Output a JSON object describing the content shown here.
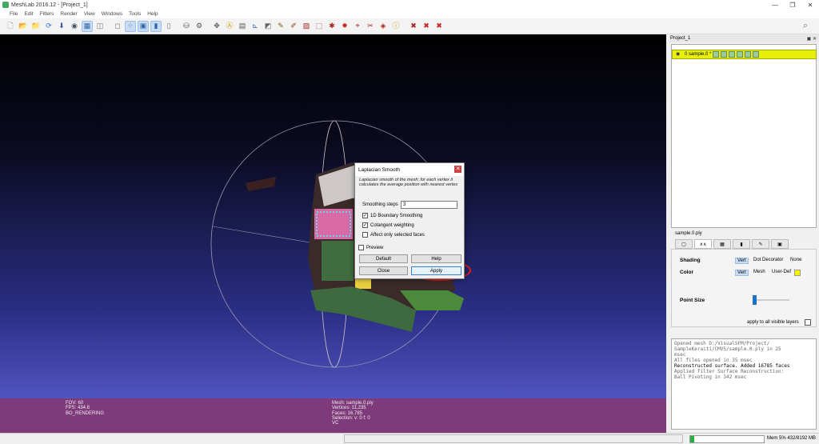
{
  "window": {
    "title": "MeshLab 2016.12 - [Project_1]",
    "minimize": "—",
    "maximize": "❐",
    "close": "✕"
  },
  "menu": [
    "File",
    "Edit",
    "Filters",
    "Render",
    "View",
    "Windows",
    "Tools",
    "Help"
  ],
  "toolbar": [
    {
      "icon": "new-project-icon",
      "glyph": "🗋",
      "color": "#888888"
    },
    {
      "icon": "open-project-icon",
      "glyph": "📂",
      "color": "#d4a017"
    },
    {
      "icon": "import-mesh-icon",
      "glyph": "📁",
      "color": "#d4a017"
    },
    {
      "icon": "reload-icon",
      "glyph": "⟳",
      "color": "#2a7ad4"
    },
    {
      "icon": "export-mesh-icon",
      "glyph": "⬇",
      "color": "#3a5aa8"
    },
    {
      "icon": "snapshot-icon",
      "glyph": "◉",
      "color": "#445566"
    },
    {
      "icon": "wireframe-icon",
      "glyph": "▦",
      "color": "#3366aa",
      "active": true
    },
    {
      "icon": "hidden-lines-icon",
      "glyph": "◫",
      "color": "#777777"
    },
    {
      "icon": "sep"
    },
    {
      "icon": "bbox-icon",
      "glyph": "◻",
      "color": "#777777"
    },
    {
      "icon": "points-icon",
      "glyph": "⁘",
      "color": "#3366aa",
      "active": true
    },
    {
      "icon": "flat-lines-icon",
      "glyph": "▣",
      "color": "#3366aa",
      "active": true
    },
    {
      "icon": "flat-icon",
      "glyph": "▮",
      "color": "#3366aa",
      "active": true
    },
    {
      "icon": "smooth-icon",
      "glyph": "▯",
      "color": "#777777"
    },
    {
      "icon": "sep"
    },
    {
      "icon": "layers-icon",
      "glyph": "⛁",
      "color": "#555555"
    },
    {
      "icon": "manipulator-icon",
      "glyph": "⚙",
      "color": "#555555"
    },
    {
      "icon": "sep"
    },
    {
      "icon": "lighting-icon",
      "glyph": "✥",
      "color": "#555555"
    },
    {
      "icon": "annotation-icon",
      "glyph": "Ⓐ",
      "color": "#c8a000"
    },
    {
      "icon": "measure-icon",
      "glyph": "▤",
      "color": "#555555"
    },
    {
      "icon": "axis-icon",
      "glyph": "⊾",
      "color": "#3366aa"
    },
    {
      "icon": "align-icon",
      "glyph": "◩",
      "color": "#666666"
    },
    {
      "icon": "paint-icon",
      "glyph": "✎",
      "color": "#7a5a20"
    },
    {
      "icon": "brush-icon",
      "glyph": "✐",
      "color": "#884422"
    },
    {
      "icon": "select-faces-icon",
      "glyph": "▨",
      "color": "#aa2222"
    },
    {
      "icon": "select-vertices-icon",
      "glyph": "⬚",
      "color": "#aa2222"
    },
    {
      "icon": "select-connected-icon",
      "glyph": "✱",
      "color": "#aa2222"
    },
    {
      "icon": "pick-points-icon",
      "glyph": "✸",
      "color": "#cc2222"
    },
    {
      "icon": "reference-icon",
      "glyph": "⌖",
      "color": "#aa2222"
    },
    {
      "icon": "cut-icon",
      "glyph": "✂",
      "color": "#aa2222"
    },
    {
      "icon": "fill-icon",
      "glyph": "◈",
      "color": "#aa2222"
    },
    {
      "icon": "info-icon",
      "glyph": "ⓘ",
      "color": "#c8a000"
    },
    {
      "icon": "sep"
    },
    {
      "icon": "delete-selected-icon",
      "glyph": "✖",
      "color": "#aa2222"
    },
    {
      "icon": "delete-faces-icon",
      "glyph": "✖",
      "color": "#cc2222"
    },
    {
      "icon": "delete-vertices-icon",
      "glyph": "✖",
      "color": "#cc2222"
    }
  ],
  "viewport_info": {
    "left": [
      "FOV: 60",
      "FPS:   434.8",
      "BO_RENDERING"
    ],
    "right": [
      "Mesh: sample.0.ply",
      "Vertices: 11,235",
      "Faces: 16,785",
      "Selection: v: 0 f: 0",
      "VC"
    ]
  },
  "layers": {
    "header": "Project_1",
    "controls": "▣ ✕",
    "mesh_label": "0  sample.0 *"
  },
  "render_panel": {
    "mesh_name": "sample.0.ply",
    "tabs": [
      "▢",
      "∧∧",
      "▦",
      "▮",
      "✎",
      "▣"
    ],
    "shading_label": "Shading",
    "shading_options": [
      "Vert",
      "Dot Decorator",
      "None"
    ],
    "color_label": "Color",
    "color_options": [
      "Vert",
      "Mesh",
      "User-Def"
    ],
    "user_color": "#f5f500",
    "point_size_label": "Point Size",
    "apply_all": "apply to all visible layers"
  },
  "log": [
    {
      "text": "Opened mesh D:/VisualSFM/Project/",
      "strong": false
    },
    {
      "text": "SampleKeraiti/CMVS/sample.0.ply in 25",
      "strong": false
    },
    {
      "text": "msec",
      "strong": false
    },
    {
      "text": "All files opened in 35 msec",
      "strong": false
    },
    {
      "text": "Reconstructed surface. Added 16785 faces",
      "strong": true
    },
    {
      "text": "Applied filter Surface Reconstruction:",
      "strong": false
    },
    {
      "text": "Ball Pivoting in 342 msec",
      "strong": false
    }
  ],
  "status": {
    "memory": "Mem 5% 432/8192 MB",
    "memory_fraction": 0.05
  },
  "dialog": {
    "title": "Laplacian Smooth",
    "close": "✕",
    "description": "Laplacian smooth of the mesh: for each vertex it calculates the average position with nearest vertex",
    "smoothing_steps_label": "Smoothing steps",
    "smoothing_steps_value": "3",
    "boundary_label": "1D Boundary Smoothing",
    "cotangent_label": "Cotangent weighting",
    "selected_label": "Affect only selected faces",
    "preview_label": "Preview",
    "default_btn": "Default",
    "help_btn": "Help",
    "close_btn": "Close",
    "apply_btn": "Apply",
    "checked": "✓"
  }
}
